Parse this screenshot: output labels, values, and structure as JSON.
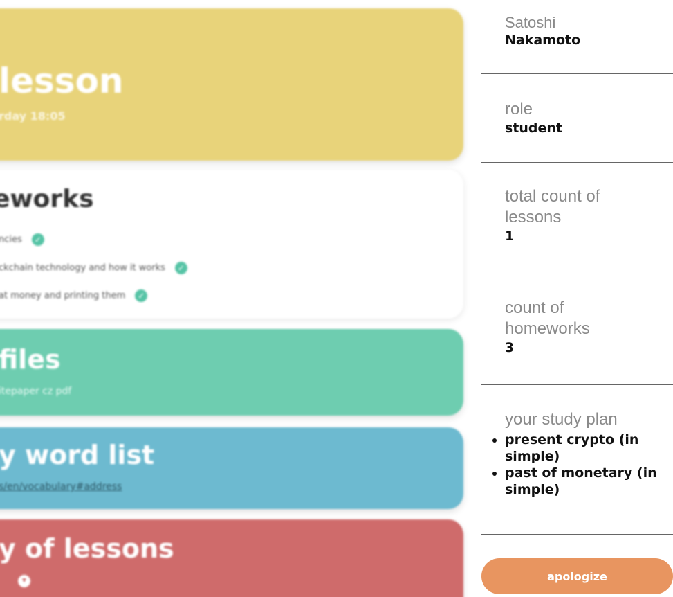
{
  "lesson": {
    "title": "lesson",
    "schedule": "rday 18:05"
  },
  "homeworks": {
    "title": "eworks",
    "items": [
      "ncies",
      "ckchain technology and how it works",
      "at money and printing them"
    ]
  },
  "files": {
    "title": "files",
    "item": "itepaper cz pdf"
  },
  "word_list": {
    "title": "y word list",
    "link": "s/en/vocabulary#address"
  },
  "history": {
    "title": "y of lessons"
  },
  "profile": {
    "first_name": "Satoshi",
    "last_name": "Nakamoto",
    "role_label": "role",
    "role_value": "student",
    "lessons_label": "total count of lessons",
    "lessons_value": "1",
    "homeworks_label": "count of homeworks",
    "homeworks_value": "3",
    "plan_label": "your study plan",
    "plan_items": [
      "present crypto (in simple)",
      "past of monetary (in simple)"
    ]
  },
  "actions": {
    "apologize_label": "apologize"
  },
  "colors": {
    "lesson_card": "#e8d37a",
    "files_card": "#6ecdb0",
    "word_card": "#6dbad0",
    "history_card": "#cf6b6b",
    "apologize_button": "#e89560",
    "check": "#56c4a6"
  }
}
